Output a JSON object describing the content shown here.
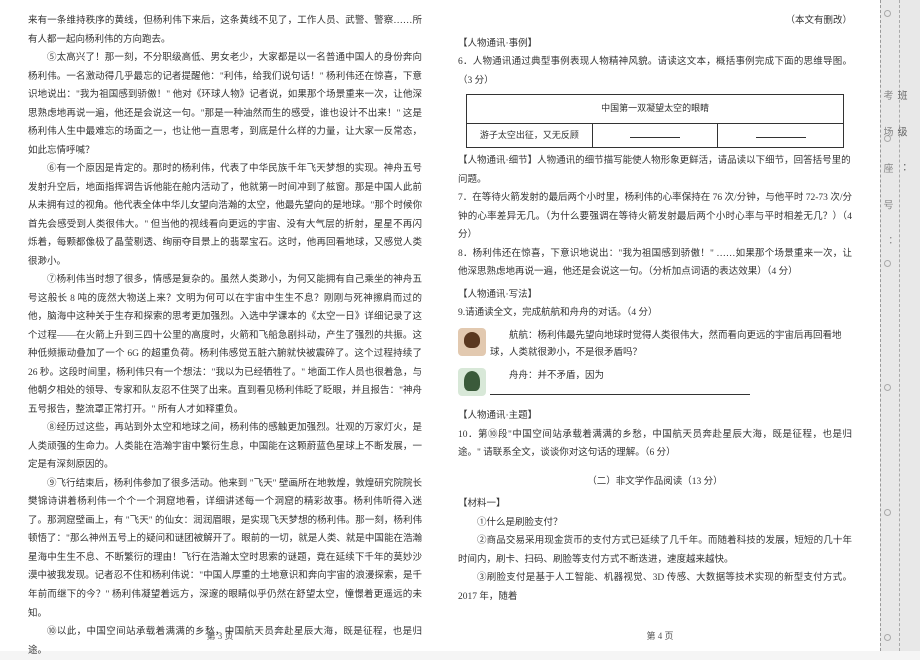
{
  "left_page": {
    "paragraphs": [
      "来有一条维持秩序的黄线，但杨利伟下来后，这条黄线不见了，工作人员、武警、警察……所有人都一起向杨利伟的方向跑去。",
      "⑤太高兴了！那一刻，不分职级高低、男女老少，大家都是以一名普通中国人的身份奔向杨利伟。一名激动得几乎最忘的记者提醒他：\"利伟，给我们说句话！\" 杨利伟还在惊喜，下意识地说出：\"我为祖国感到骄傲！\" 他对《环球人物》记者说，如果那个场景重来一次，让他深思熟虑地再说一遍，他还是会说这一句。\"那是一种油然而生的感受，谁也设计不出来！\" 这是杨利伟人生中最难忘的场面之一，也让他一直思考，到底是什么样的力量，让大家一反常态，如此忘情呼喊？",
      "⑥有一个原因是肯定的。那时的杨利伟，代表了中华民族千年飞天梦想的实现。神舟五号发射升空后，地面指挥调告诉他能在舱内活动了，他就第一时间冲到了舷窗。那是中国人此前从未拥有过的视角。他代表全体中华儿女望向浩瀚的太空，他最先望向的是地球。\"那个时候你首先会感受到人类很伟大。\" 但当他的视线看向更远的宇宙、没有大气层的折射，星星不再闪烁着，每颗都像极了晶莹剔透、绚丽夺目景上的翡翠宝石。这时，他再回看地球，又感觉人类很渺小。",
      "⑦杨利伟当时想了很多，情感是复杂的。虽然人类渺小，为何又能拥有自己乘坐的神舟五号这般长 8 吨的庞然大物送上来？文明为何可以在宇宙中生生不息？刚刚与死神擦肩而过的他，脑海中这种关于生存和探索的思考更加强烈。入选中学课本的《太空一日》详细记录了这个过程——在火箭上升到三四十公里的高度时，火箭和飞船急剧抖动，产生了强烈的共振。这种低频振动叠加了一个 6G 的超重负荷。杨利伟感觉五脏六腑就快被震碎了。这个过程持续了 26 秒。这段时间里，杨利伟只有一个想法：\"我以为已经牺牲了。\" 地面工作人员也很着急，与他朝夕相处的领导、专家和队友忍不住哭了出来。直到看见杨利伟眨了眨眼，并且报告：\"神舟五号报告，整流罩正常打开。\" 所有人才如释重负。",
      "⑧经历过这些，再站到外太空和地球之间，杨利伟的感触更加强烈。壮观的万家灯火，是人类顽强的生命力。人类能在浩瀚宇宙中繁衍生息，中国能在这颗蔚蓝色星球上不断发展，一定是有深刻原因的。",
      "⑨飞行结束后，杨利伟参加了很多活动。他来到 \"飞天\" 壁画所在地敦煌，敦煌研究院院长樊锦诗讲着杨利伟一个个一个洞窟地看，详细讲述每一个洞窟的精彩故事。杨利伟听得入迷了。那洞窟壁画上，有 \"飞天\" 的仙女：润润眉眼，是实现飞天梦想的杨利伟。那一刻，杨利伟顿悟了：\"那么神州五号上的疑问和谜团被解开了。眼前的一切，就是人类、就是中国能在浩瀚星海中生生不息、不断繁衍的理由！飞行在浩瀚太空时思索的谜题，竟在延续下千年的莫妙沙漠中被我发现。记者忍不住和杨利伟说：\"中国人厚重的土地意识和奔向宇宙的浪漫探索，是千年前而继下的今？\" 杨利伟凝望着远方，深邃的眼睛似乎仍然在舒望太空，憧憬着更遥远的未知。",
      "⑩以此，中国空间站承载着满满的乡愁，中国航天员奔赴星辰大海，既是征程，也是归途。"
    ],
    "footer": "第 3 页"
  },
  "right_page": {
    "attribution": "（本文有删改）",
    "tag1": "【人物通讯·事例】",
    "q6_intro": "6．人物通讯通过典型事例表现人物精神风貌。请读这文本，概括事例完成下面的思维导图。（3 分）",
    "chart_data": {
      "type": "table",
      "title": "中国第一双凝望太空的眼睛",
      "rows": [
        [
          "游子太空出征，又无反顾",
          "",
          ""
        ]
      ]
    },
    "tag2": "【人物通讯·细节】人物通讯的细节描写能使人物形象更鲜活，请品读以下细节，回答括号里的问题。",
    "q7": "7．在等待火箭发射的最后两个小时里，杨利伟的心率保持在 76 次/分钟，与他平时 72-73 次/分钟的心率差异无几。（为什么要强调在等待火箭发射最后两个小时心率与平时相差无几？）（4 分）",
    "q8": "8．杨利伟还在惊喜，下意识地说出：\"我为祖国感到骄傲！\" ……如果那个场景重来一次，让他深思熟虑地再说一遍，他还是会说这一句。（分析加点词语的表达效果）（4 分）",
    "tag3": "【人物通讯·写法】",
    "q9_intro": "9.请通读全文，完成航航和舟舟的对话。（4 分）",
    "hanghang_label": "航航：",
    "hanghang_text": "杨利伟最先望向地球时觉得人类很伟大，然而看向更远的宇宙后再回看地球，人类就很渺小，不是很矛盾吗？",
    "zhouzhou_label": "舟舟：",
    "zhouzhou_text": "并不矛盾，因为",
    "tag4": "【人物通讯·主题】",
    "q10": "10．第⑩段\"中国空间站承载着满满的乡愁，中国航天员奔赴星辰大海，既是征程，也是归途。\" 请联系全文，谈谈你对这句话的理解。（6 分）",
    "section2": "（二）非文学作品阅读（13 分）",
    "material1": "【材料一】",
    "m1_q1": "①什么是刷脸支付？",
    "m1_q2": "②商品交易采用现金货币的支付方式已延续了几千年。而随着科技的发展，短短的几十年时间内，刷卡、扫码、刷脸等支付方式不断迭进，速度越来越快。",
    "m1_q3": "③刷脸支付是基于人工智能、机器视觉、3D 传感、大数据等技术实现的新型支付方式。2017 年，随着",
    "footer": "第 4 页"
  },
  "side": {
    "line1": "班 级 ：",
    "line2": "考 场 座 号 ："
  }
}
